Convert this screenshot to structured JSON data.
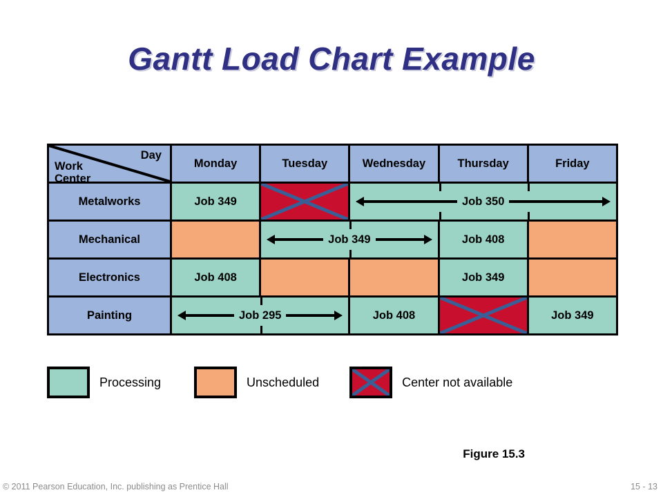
{
  "slide": {
    "title": "Gantt Load Chart Example",
    "title_color": "#2f2f84",
    "figure_caption": "Figure 15.3",
    "footer_left": "© 2011 Pearson Education, Inc. publishing as Prentice Hall",
    "footer_right": "15 - 13"
  },
  "chart_data": {
    "type": "table",
    "title": "Gantt Load Chart Example",
    "corner_row_header": "Work\nCenter",
    "corner_row_header_line1": "Work",
    "corner_row_header_line2": "Center",
    "corner_col_header": "Day",
    "categories": [
      "Monday",
      "Tuesday",
      "Wednesday",
      "Thursday",
      "Friday"
    ],
    "xlabel": "Day",
    "ylabel": "Work Center",
    "grid": true,
    "legend_position": "below",
    "colors": {
      "header": "#9db4dc",
      "processing": "#9bd4c4",
      "unscheduled": "#f5a878",
      "unavailable": "#c8102e",
      "x_mark": "#3a5f96",
      "border": "#000000"
    },
    "rows": [
      {
        "label": "Metalworks",
        "cells": [
          {
            "day": "Monday",
            "state": "processing",
            "label": "Job 349",
            "span": 1,
            "arrows": "none"
          },
          {
            "day": "Tuesday",
            "state": "unavailable",
            "label": "",
            "span": 1,
            "arrows": "none"
          },
          {
            "day": "Wednesday",
            "state": "processing",
            "label": "Job 350",
            "span": 3,
            "arrows": "both",
            "spans_days": [
              "Wednesday",
              "Thursday",
              "Friday"
            ]
          }
        ]
      },
      {
        "label": "Mechanical",
        "cells": [
          {
            "day": "Monday",
            "state": "unscheduled",
            "label": "",
            "span": 1,
            "arrows": "none"
          },
          {
            "day": "Tuesday",
            "state": "processing",
            "label": "Job 349",
            "span": 2,
            "arrows": "both",
            "spans_days": [
              "Tuesday",
              "Wednesday"
            ]
          },
          {
            "day": "Thursday",
            "state": "processing",
            "label": "Job 408",
            "span": 1,
            "arrows": "none"
          },
          {
            "day": "Friday",
            "state": "unscheduled",
            "label": "",
            "span": 1,
            "arrows": "none"
          }
        ]
      },
      {
        "label": "Electronics",
        "cells": [
          {
            "day": "Monday",
            "state": "processing",
            "label": "Job 408",
            "span": 1,
            "arrows": "none"
          },
          {
            "day": "Tuesday",
            "state": "unscheduled",
            "label": "",
            "span": 1,
            "arrows": "none"
          },
          {
            "day": "Wednesday",
            "state": "unscheduled",
            "label": "",
            "span": 1,
            "arrows": "none"
          },
          {
            "day": "Thursday",
            "state": "processing",
            "label": "Job 349",
            "span": 1,
            "arrows": "none"
          },
          {
            "day": "Friday",
            "state": "unscheduled",
            "label": "",
            "span": 1,
            "arrows": "none"
          }
        ]
      },
      {
        "label": "Painting",
        "cells": [
          {
            "day": "Monday",
            "state": "processing",
            "label": "Job 295",
            "span": 2,
            "arrows": "both",
            "spans_days": [
              "Monday",
              "Tuesday"
            ]
          },
          {
            "day": "Wednesday",
            "state": "processing",
            "label": "Job 408",
            "span": 1,
            "arrows": "none"
          },
          {
            "day": "Thursday",
            "state": "unavailable",
            "label": "",
            "span": 1,
            "arrows": "none"
          },
          {
            "day": "Friday",
            "state": "processing",
            "label": "Job 349",
            "span": 1,
            "arrows": "none"
          }
        ]
      }
    ],
    "legend": [
      {
        "state": "processing",
        "label": "Processing",
        "color": "#9bd4c4"
      },
      {
        "state": "unscheduled",
        "label": "Unscheduled",
        "color": "#f5a878"
      },
      {
        "state": "unavailable",
        "label": "Center not available",
        "color": "#c8102e"
      }
    ]
  }
}
